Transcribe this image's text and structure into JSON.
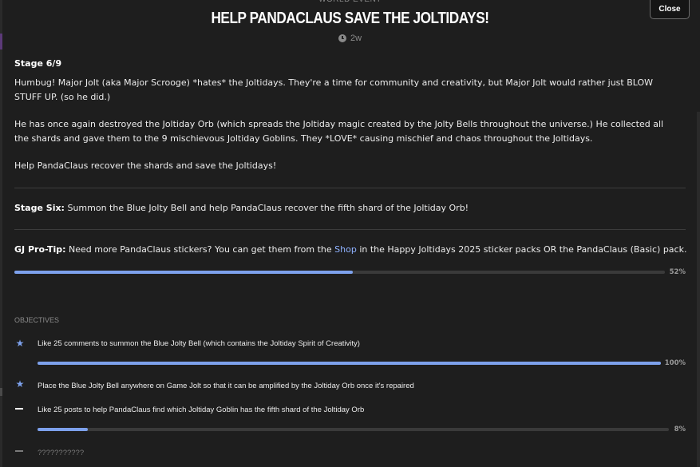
{
  "header": {
    "event_type": "WORLD EVENT",
    "title": "Help PandaClaus Save The Joltidays!",
    "timestamp": "2w",
    "close_label": "Close"
  },
  "content": {
    "stage": "Stage 6/9",
    "para1": "Humbug! Major Jolt (aka Major Scrooge) *hates* the Joltidays. They're a time for community and creativity, but Major Jolt would rather just BLOW STUFF UP. (so he did.)",
    "para2": "He has once again destroyed the Joltiday Orb (which spreads the Joltiday magic created by the Jolty Bells throughout the universe.) He collected all the shards and gave them to the 9 mischievous Joltiday Goblins. They *LOVE* causing mischief and chaos throughout the Joltidays.",
    "para3": "Help PandaClaus recover the shards and save the Joltidays!",
    "stage_six_label": "Stage Six:",
    "stage_six_text": " Summon the Blue Jolty Bell and help PandaClaus recover the fifth shard of the Joltiday Orb!",
    "protip_label": "GJ Pro-Tip:",
    "protip_pre": " Need more PandaClaus stickers? You can get them from the ",
    "protip_link": "Shop",
    "protip_post": " in the Happy Joltidays 2025 sticker packs OR the PandaClaus (Basic) pack."
  },
  "progress": {
    "value": 0.52,
    "label": "52%"
  },
  "objectives": {
    "label": "OBJECTIVES",
    "items": [
      {
        "text": "Like 25 comments to summon the Blue Jolty Bell (which contains the Joltiday Spirit of Creativity)",
        "state": "complete",
        "progress": 1.0,
        "progress_label": "100%"
      },
      {
        "text": "Place the Blue Jolty Bell anywhere on Game Jolt so that it can be amplified by the Joltiday Orb once it's repaired",
        "state": "complete"
      },
      {
        "text": "Like 25 posts to help PandaClaus find which Joltiday Goblin has the fifth shard of the Joltiday Orb",
        "state": "in-progress",
        "progress": 0.08,
        "progress_label": "8%"
      },
      {
        "text": "???????????",
        "state": "locked"
      }
    ]
  },
  "colors": {
    "accent": "#7da1ec",
    "background": "#1e1e1e",
    "link": "#8fb2ff"
  },
  "icons": {
    "timestamp": "clock-icon",
    "complete": "star-icon",
    "incomplete": "dash-icon"
  }
}
